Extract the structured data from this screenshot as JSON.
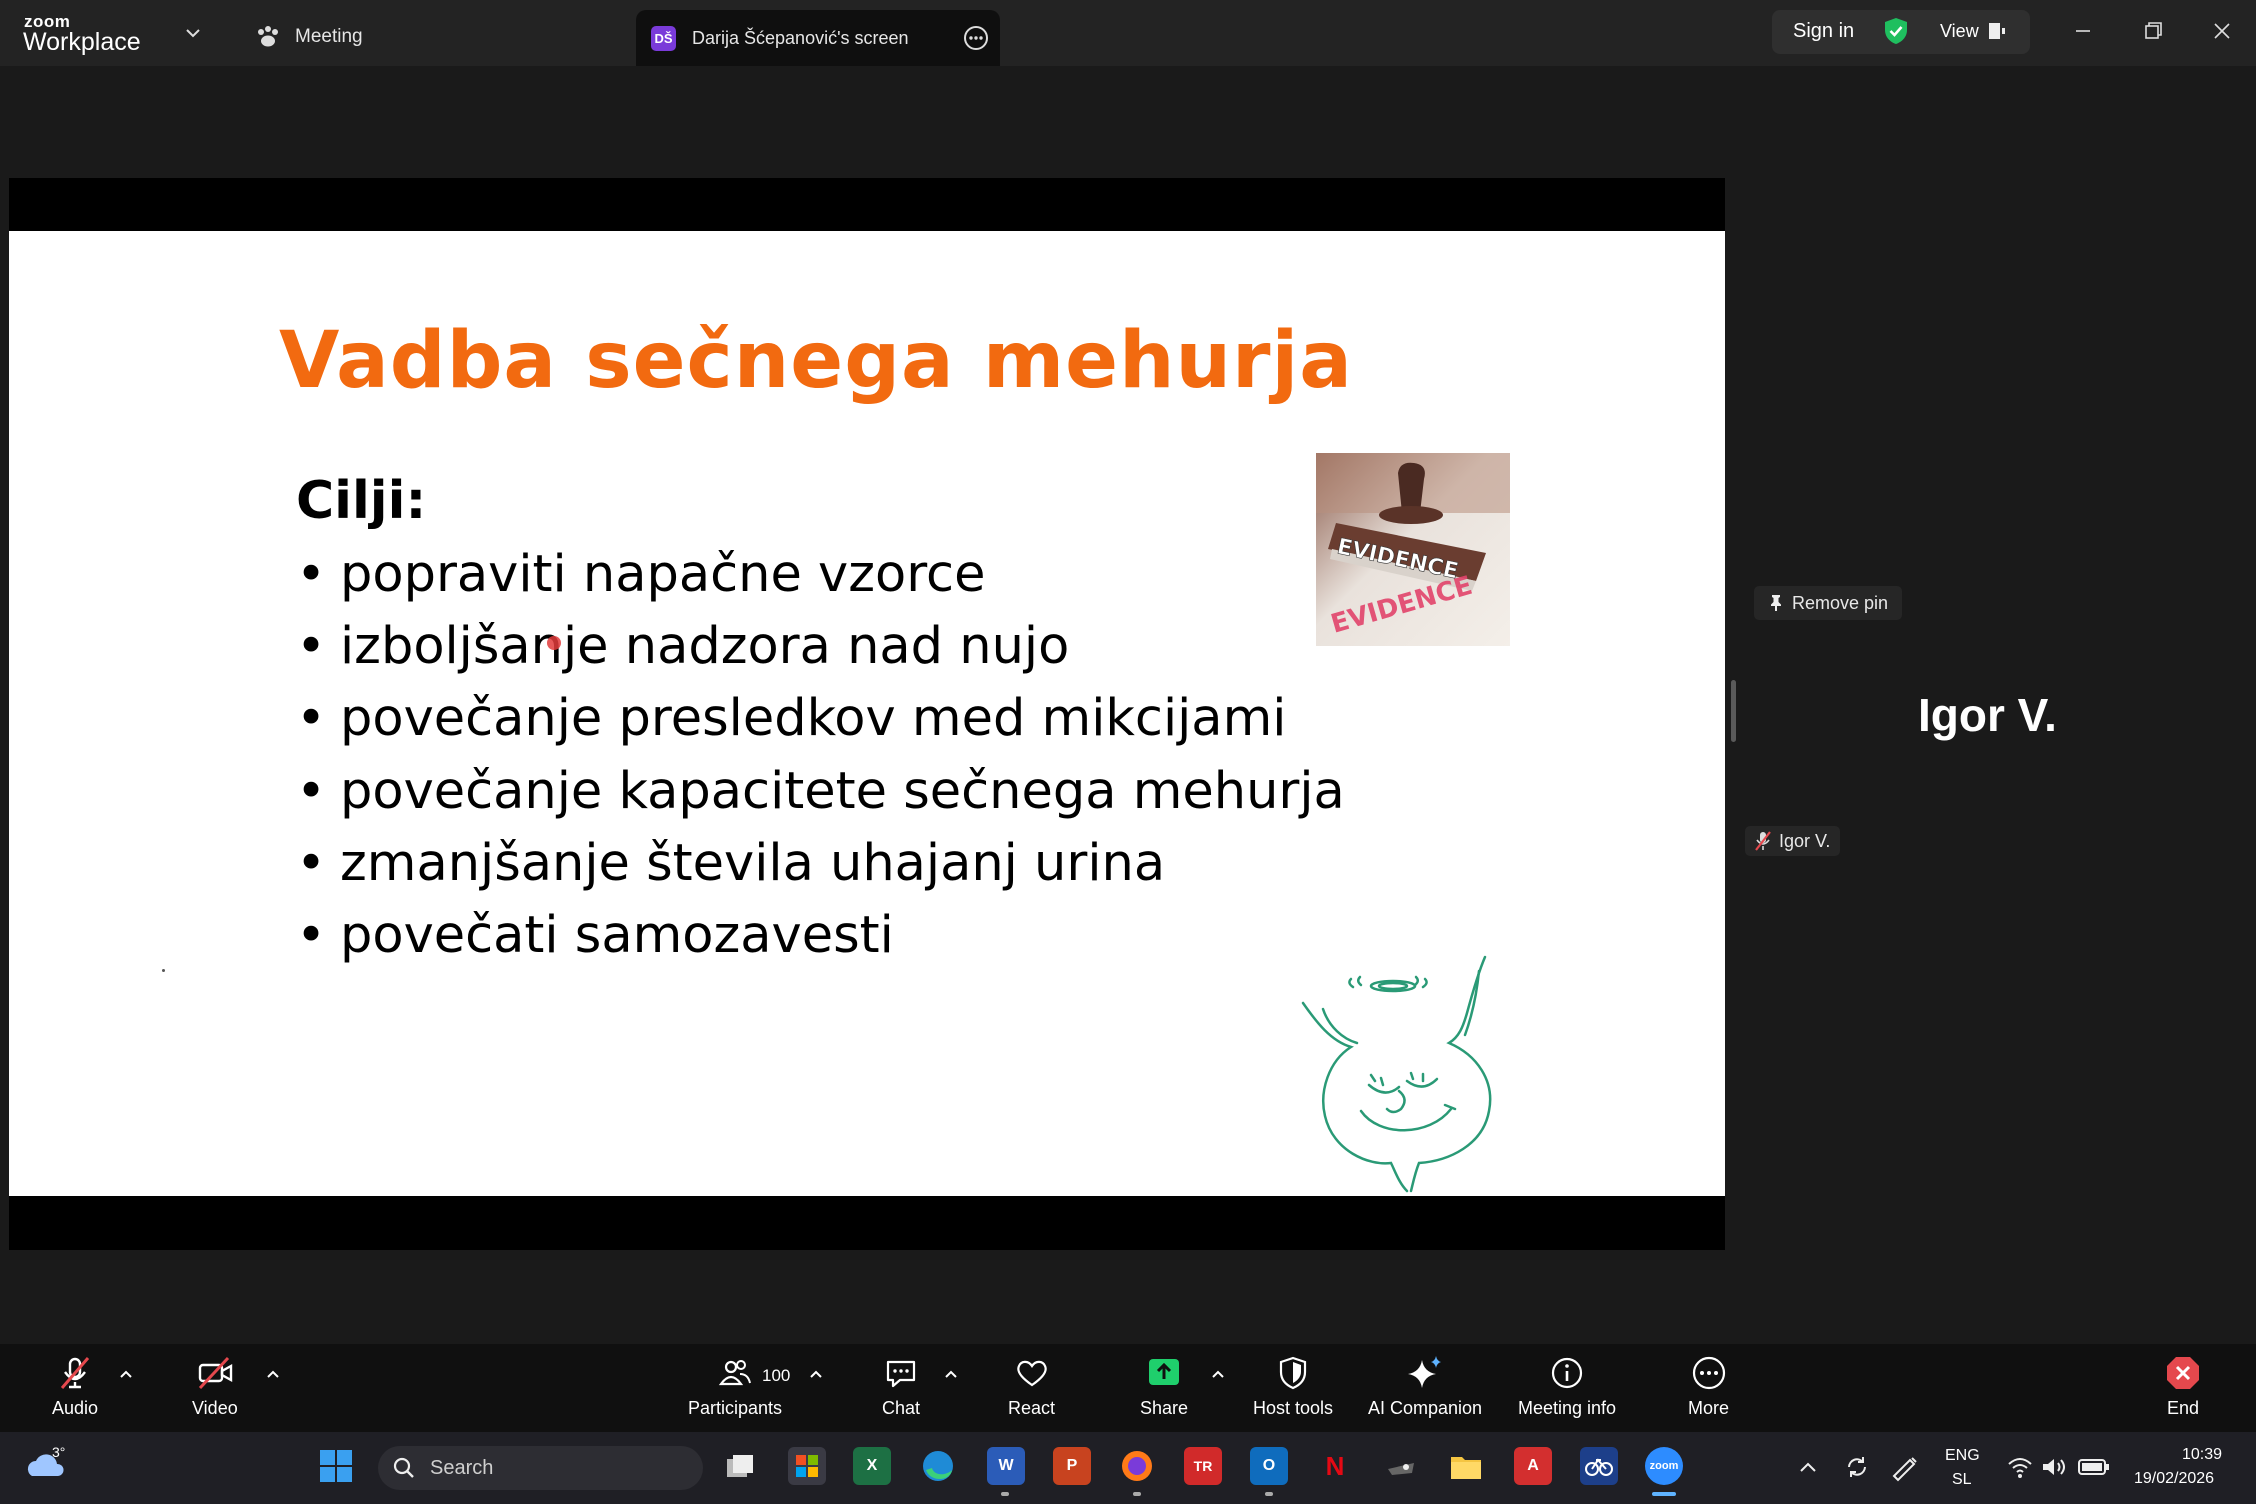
{
  "app": {
    "logo_small": "zoom",
    "logo_big": "Workplace"
  },
  "tabs": {
    "meeting": "Meeting",
    "screen_avatar": "DŠ",
    "screen": "Darija Šćepanović's screen"
  },
  "topbar": {
    "sign_in": "Sign in",
    "view": "View"
  },
  "slide": {
    "title": "Vadba sečnega mehurja",
    "subtitle": "Cilji:",
    "bullets": [
      "popraviti napačne vzorce",
      "izboljšanje nadzora nad nujo",
      "povečanje presledkov med mikcijami",
      "povečanje kapacitete sečnega mehurja",
      "zmanjšanje števila uhajanj urina",
      "povečati samozavesti"
    ],
    "image_stamp_text": "EVIDENCE",
    "accent_color": "#f26a10"
  },
  "participant_panel": {
    "remove_pin": "Remove pin",
    "name_large": "Igor V.",
    "name_tag": "Igor V."
  },
  "controls": {
    "audio": "Audio",
    "video": "Video",
    "participants": "Participants",
    "participant_count": "100",
    "chat": "Chat",
    "react": "React",
    "share": "Share",
    "host_tools": "Host tools",
    "ai_companion": "AI Companion",
    "meeting_info": "Meeting info",
    "more": "More",
    "end": "End"
  },
  "taskbar": {
    "weather_temp": "3°",
    "search_placeholder": "Search",
    "lang_line1": "ENG",
    "lang_line2": "SL",
    "time": "10:39",
    "date": "19/02/2026"
  }
}
